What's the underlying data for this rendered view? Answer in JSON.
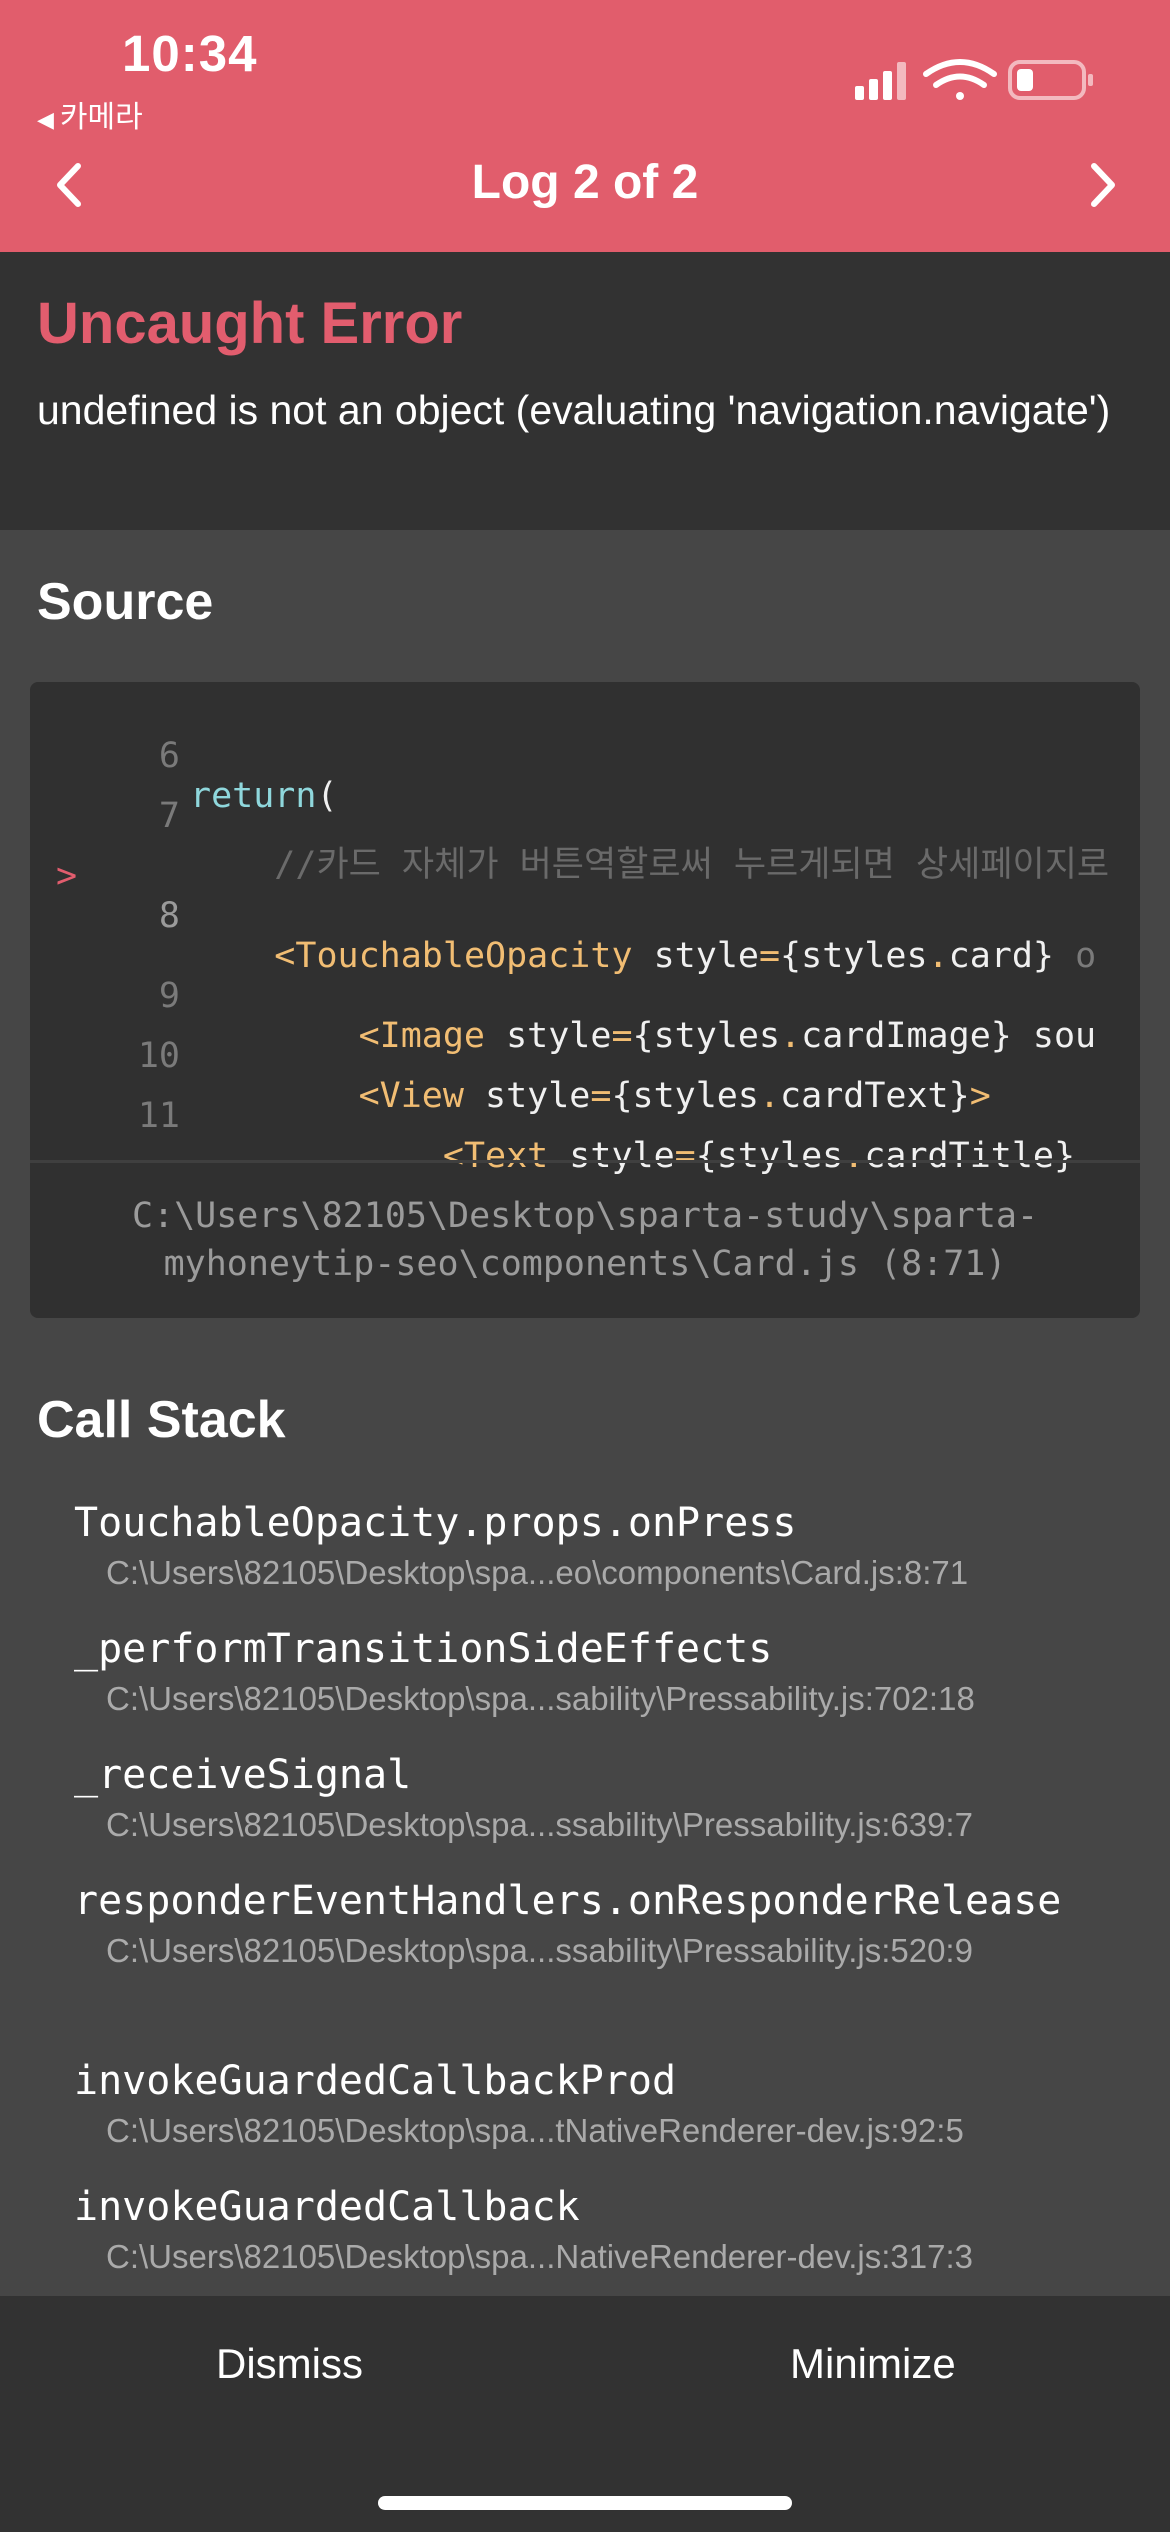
{
  "status_bar": {
    "time": "10:34",
    "back_app_label": "카메라",
    "icons": [
      "signal-icon",
      "wifi-icon",
      "battery-icon"
    ]
  },
  "header": {
    "title": "Log 2 of 2",
    "prev_icon": "chevron-left-icon",
    "next_icon": "chevron-right-icon",
    "background": "#e15d6c"
  },
  "error": {
    "type": "Uncaught Error",
    "message": "undefined is not an object (evaluating 'navigation.navigate')",
    "accent": "#e25d6e"
  },
  "source": {
    "title": "Source",
    "lines": [
      {
        "number": "6",
        "active": false,
        "text": "return("
      },
      {
        "number": "7",
        "active": false,
        "text": "    //카드 자체가 버튼역할로써 누르게되면 상세페이지로"
      },
      {
        "number": "8",
        "active": true,
        "marker": ">",
        "text": "    <TouchableOpacity style={styles.card} o"
      },
      {
        "number": "9",
        "active": false,
        "text": "        <Image style={styles.cardImage} sou"
      },
      {
        "number": "10",
        "active": false,
        "text": "        <View style={styles.cardText}>"
      },
      {
        "number": "11",
        "active": false,
        "text": "            <Text style={styles.cardTitle}"
      }
    ],
    "file_path": "C:\\Users\\82105\\Desktop\\sparta-study\\sparta-myhoneytip-seo\\components\\Card.js (8:71)"
  },
  "call_stack": {
    "title": "Call Stack",
    "frames": [
      {
        "fn": "TouchableOpacity.props.onPress",
        "loc": "C:\\Users\\82105\\Desktop\\spa...eo\\components\\Card.js:8:71"
      },
      {
        "fn": "_performTransitionSideEffects",
        "loc": "C:\\Users\\82105\\Desktop\\spa...sability\\Pressability.js:702:18"
      },
      {
        "fn": "_receiveSignal",
        "loc": "C:\\Users\\82105\\Desktop\\spa...ssability\\Pressability.js:639:7"
      },
      {
        "fn": "responderEventHandlers.onResponderRelease",
        "loc": "C:\\Users\\82105\\Desktop\\spa...ssability\\Pressability.js:520:9"
      },
      {
        "fn": "invokeGuardedCallbackProd",
        "loc": "C:\\Users\\82105\\Desktop\\spa...tNativeRenderer-dev.js:92:5"
      },
      {
        "fn": "invokeGuardedCallback",
        "loc": "C:\\Users\\82105\\Desktop\\spa...NativeRenderer-dev.js:317:3"
      }
    ]
  },
  "footer": {
    "dismiss_label": "Dismiss",
    "minimize_label": "Minimize"
  }
}
